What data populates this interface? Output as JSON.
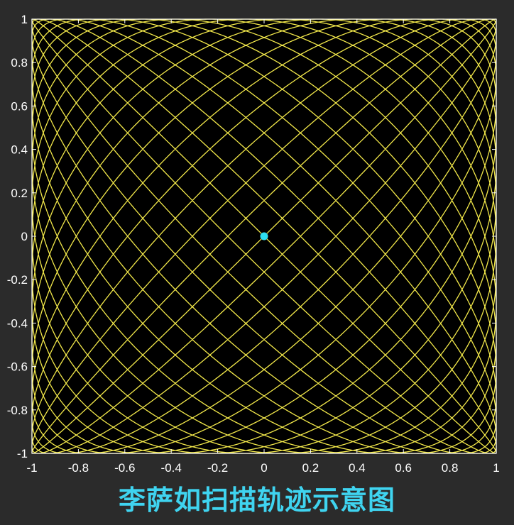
{
  "chart_data": {
    "type": "line",
    "title": "李萨如扫描轨迹示意图",
    "xlabel": "",
    "ylabel": "",
    "xlim": [
      -1,
      1
    ],
    "ylim": [
      -1,
      1
    ],
    "x_ticks": [
      -1,
      -0.8,
      -0.6,
      -0.4,
      -0.2,
      0,
      0.2,
      0.4,
      0.6,
      0.8,
      1
    ],
    "x_tick_labels": [
      "-1",
      "-0.8",
      "-0.6",
      "-0.4",
      "-0.2",
      "0",
      "0.2",
      "0.4",
      "0.6",
      "0.8",
      "1"
    ],
    "y_ticks": [
      -1,
      -0.8,
      -0.6,
      -0.4,
      -0.2,
      0,
      0.2,
      0.4,
      0.6,
      0.8,
      1
    ],
    "y_tick_labels": [
      "-1",
      "-0.8",
      "-0.6",
      "-0.4",
      "-0.2",
      "0",
      "0.2",
      "0.4",
      "0.6",
      "0.8",
      "1"
    ],
    "grid": false,
    "series": [
      {
        "kind": "lissajous",
        "x_expr": "sin(a*t)",
        "y_expr": "sin(b*t)",
        "a": 19,
        "b": 20,
        "amplitude": 1.0,
        "color": "#f2e84a"
      }
    ],
    "points": [
      {
        "x": 0,
        "y": 0,
        "color": "#2fe0f0"
      }
    ],
    "colors": {
      "background": "#2b2b2b",
      "plot_background": "#000000",
      "axes": "#ffffff",
      "curve": "#f2e84a",
      "marker": "#2fe0f0",
      "title": "#3fd4f0"
    }
  }
}
